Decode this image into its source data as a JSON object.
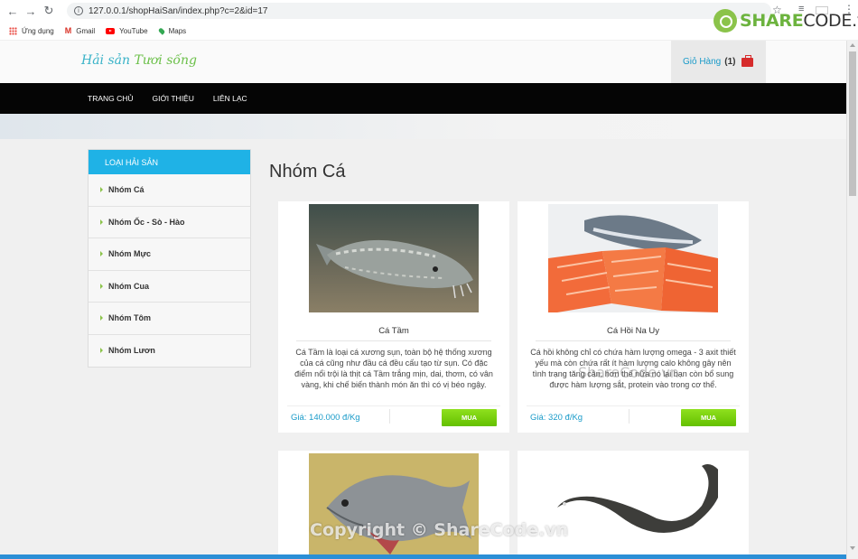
{
  "browser": {
    "url": "127.0.0.1/shopHaiSan/index.php?c=2&id=17",
    "bookmarks": [
      {
        "label": "Ứng dụng",
        "icon": "apps-icon"
      },
      {
        "label": "Gmail",
        "icon": "gmail-icon"
      },
      {
        "label": "YouTube",
        "icon": "youtube-icon"
      },
      {
        "label": "Maps",
        "icon": "maps-icon"
      }
    ]
  },
  "watermark_logo": {
    "share": "SHARE",
    "code": "CODE.vn"
  },
  "site": {
    "logo_part1": "Hải sản ",
    "logo_part2": "Tươi sống",
    "cart_label": "Giỏ Hàng",
    "cart_count": "(1)",
    "nav": [
      "TRANG CHỦ",
      "GIỚI THIỆU",
      "LIÊN LẠC"
    ]
  },
  "sidebar": {
    "title": "LOẠI HẢI SẢN",
    "items": [
      "Nhóm Cá",
      "Nhóm Ốc - Sò - Hào",
      "Nhóm Mực",
      "Nhóm Cua",
      "Nhóm Tôm",
      "Nhóm Lươn"
    ]
  },
  "page_title": "Nhóm Cá",
  "products": [
    {
      "name": "Cá Tầm",
      "description": "Cá Tầm là loại cá xương sụn, toàn bộ hệ thống xương của cá cũng như đầu cá đều cấu tạo từ sụn. Có đặc điểm nổi trội là thịt cá Tầm trắng mịn, dai, thơm, có vân vàng, khi chế biến thành món ăn thì có vị béo ngậy.",
      "price": "Giá: 140.000 đ/Kg",
      "buy_label": "MUA"
    },
    {
      "name": "Cá Hồi Na Uy",
      "description": "Cá hồi không chỉ có chứa hàm lượng omega - 3 axit thiết yếu mà còn chứa rất ít hàm lượng calo không gây nên tình trạng tăng cân, hơn thế nữa nó lại bạn còn bổ sung được hàm lượng sắt, protein vào trong cơ thể.",
      "price": "Giá: 320 đ/Kg",
      "buy_label": "MUA"
    }
  ],
  "watermarks": {
    "center": "ShareCode.vn",
    "bottom": "Copyright © ShareCode.vn"
  },
  "colors": {
    "accent": "#1fb2e6",
    "buy": "#64c000",
    "nav_bg": "#050505",
    "price": "#1a9bc9"
  }
}
